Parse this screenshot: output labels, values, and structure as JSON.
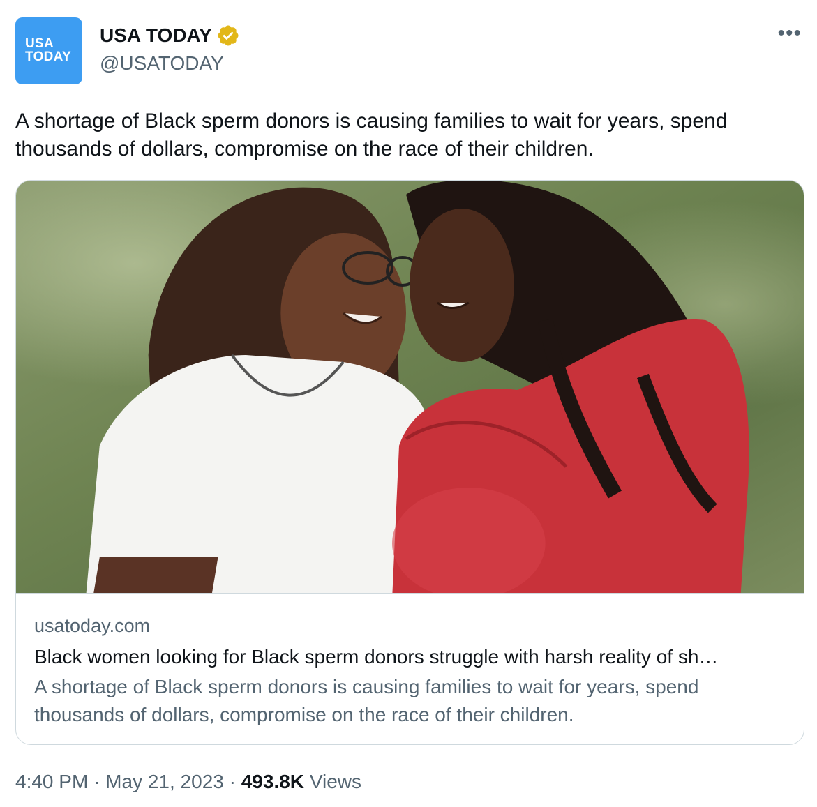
{
  "author": {
    "avatar_line1": "USA",
    "avatar_line2": "TODAY",
    "display_name": "USA TODAY",
    "handle": "@USATODAY",
    "verified_badge": "gold-verified-icon"
  },
  "more_icon": "more-options-icon",
  "tweet": {
    "text": "A shortage of Black sperm donors is causing families to wait for years, spend thousands of dollars, compromise on the race of their children."
  },
  "card": {
    "image": "photo of two smiling women, one pregnant in red dress",
    "domain": "usatoday.com",
    "title": "Black women looking for Black sperm donors struggle with harsh reality of sh…",
    "description": "A shortage of Black sperm donors is causing families to wait for years, spend thousands of dollars, compromise on the race of their children."
  },
  "meta": {
    "time": "4:40 PM",
    "separator": "·",
    "date": "May 21, 2023",
    "views_count": "493.8K",
    "views_label": "Views"
  },
  "colors": {
    "avatar_bg": "#3d9df2",
    "verified_gold": "#e2b719",
    "text_primary": "#0f1419",
    "text_secondary": "#536471",
    "border": "#cfd9de"
  }
}
